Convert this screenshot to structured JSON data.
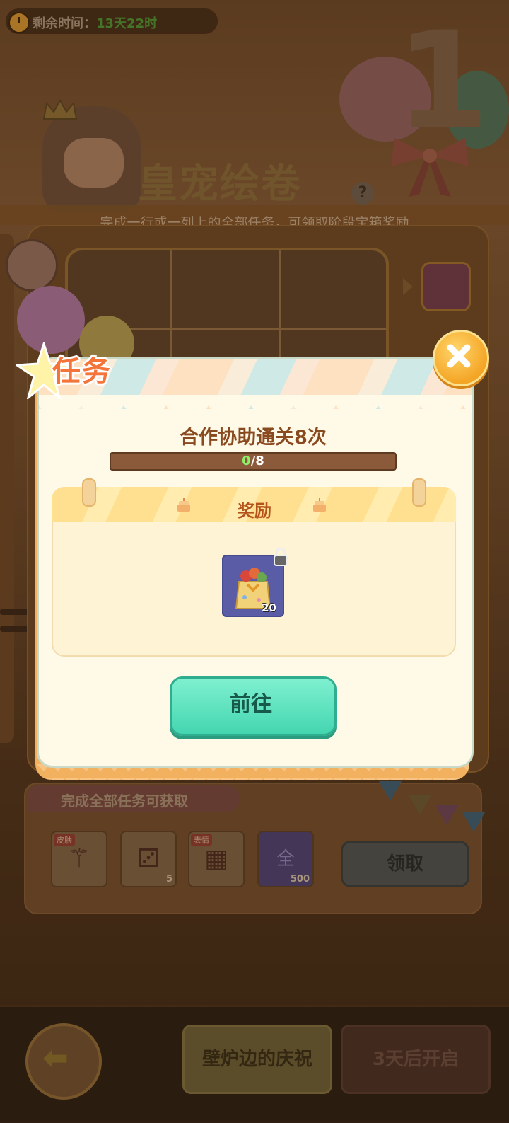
{
  "event": {
    "timer_label": "剩余时间：",
    "timer_value": "13天22时",
    "title": "皇宠绘卷",
    "big_number": "1",
    "subtitle": "完成一行或一列上的全部任务，可领取阶段宝箱奖励",
    "help_label": "?"
  },
  "dialog": {
    "title": "任务",
    "task_name": "合作协助通关8次",
    "progress": {
      "current": "0",
      "separator": "/",
      "total": "8",
      "fraction": 0
    },
    "reward_title": "奖励",
    "reward_item": {
      "icon": "gift-bag-icon",
      "count": "20",
      "locked": true
    },
    "go_button": "前往"
  },
  "completion_panel": {
    "title": "完成全部任务可获取",
    "items": [
      {
        "tag": "皮肤",
        "icon": "wand-icon",
        "count": ""
      },
      {
        "tag": "",
        "icon": "dice-icon",
        "count": "5"
      },
      {
        "tag": "表情",
        "icon": "party-box-icon",
        "count": ""
      },
      {
        "tag": "",
        "icon": "coin-icon",
        "glyph": "全",
        "count": "500"
      }
    ],
    "claim_button": "领取"
  },
  "bottom_nav": {
    "current_stage": "壁炉边的庆祝",
    "next_stage": "3天后开启"
  },
  "colors": {
    "accent_orange": "#f4743a",
    "go_button": "#44d6b0",
    "progress_fill": "#6ad26a"
  }
}
